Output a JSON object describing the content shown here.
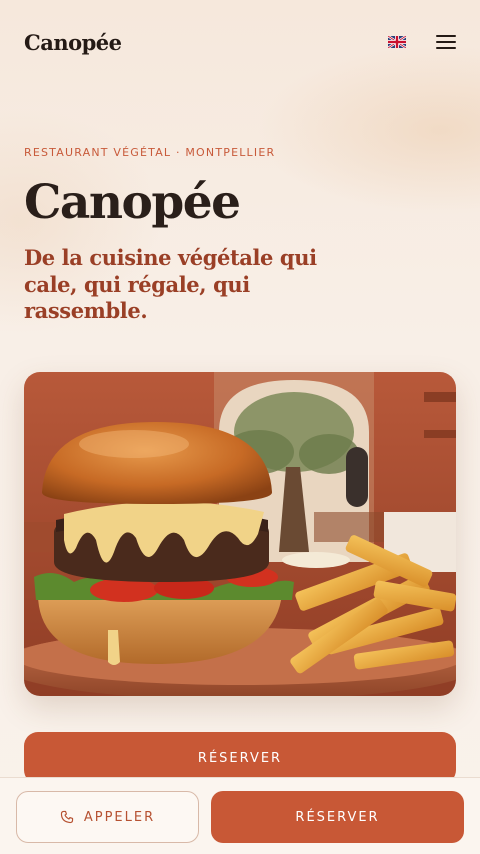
{
  "header": {
    "brand": "Canopée",
    "language_icon": "uk-flag-icon",
    "menu_icon": "hamburger-menu-icon"
  },
  "hero": {
    "eyebrow": "RESTAURANT VÉGÉTAL · MONTPELLIER",
    "title": "Canopée",
    "subtitle": "De la cuisine végétale qui cale, qui régale, qui rassemble.",
    "image_alt": "Burger végétal avec frites sur une terrasse"
  },
  "cta": {
    "reserve_label": "RÉSERVER"
  },
  "bottom_bar": {
    "call_label": "APPELER",
    "call_icon": "phone-icon",
    "reserve_label": "RÉSERVER"
  },
  "colors": {
    "accent": "#c85836",
    "subtitle": "#9a3f26",
    "background": "#f7ede4"
  }
}
